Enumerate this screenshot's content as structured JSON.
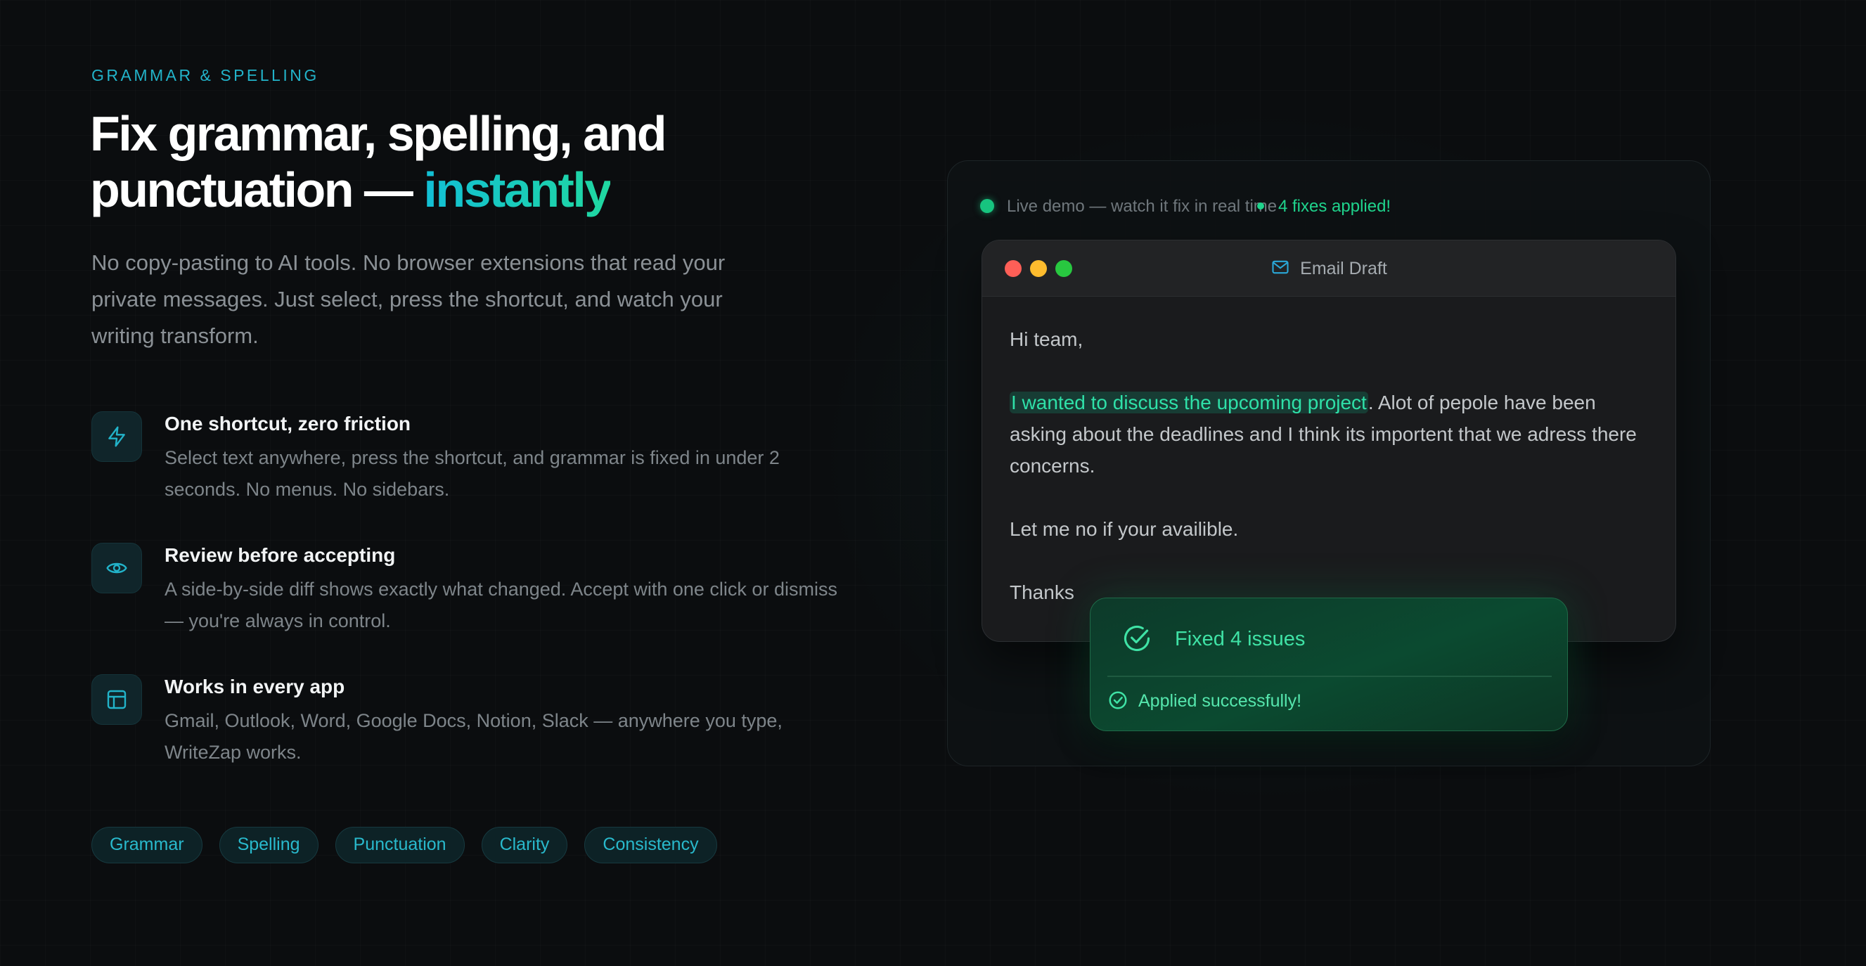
{
  "hero": {
    "eyebrow": "GRAMMAR & SPELLING",
    "headline_part1": "Fix grammar, spelling, and punctuation — ",
    "headline_accent": "instantly",
    "lede": "No copy-pasting to AI tools. No browser extensions that read your private messages. Just select, press the shortcut, and watch your writing transform."
  },
  "features": [
    {
      "icon": "lightning-icon",
      "title": "One shortcut, zero friction",
      "description": "Select text anywhere, press the shortcut, and grammar is fixed in under 2 seconds. No menus. No sidebars."
    },
    {
      "icon": "eye-icon",
      "title": "Review before accepting",
      "description": "A side-by-side diff shows exactly what changed. Accept with one click or dismiss — you're always in control."
    },
    {
      "icon": "layout-icon",
      "title": "Works in every app",
      "description": "Gmail, Outlook, Word, Google Docs, Notion, Slack — anywhere you type, WriteZap works."
    }
  ],
  "tags": [
    "Grammar",
    "Spelling",
    "Punctuation",
    "Clarity",
    "Consistency"
  ],
  "demo": {
    "live_label": "Live demo — watch it fix in real time",
    "fixes_label": "4 fixes applied!",
    "window_title": "Email Draft",
    "email": {
      "greeting": "Hi team,",
      "highlighted": "I wanted to discuss the upcoming project",
      "para1_rest": ". Alot of pepole have been asking about the deadlines and I think its importent that we adress there concerns.",
      "para2": "Let me no if your availible.",
      "signoff": "Thanks"
    },
    "toast": {
      "title": "Fixed 4 issues",
      "subtitle": "Applied successfully!"
    }
  },
  "colors": {
    "accent_cyan": "#22b3c9",
    "accent_green": "#1fd48d",
    "background": "#0b0d0f"
  }
}
